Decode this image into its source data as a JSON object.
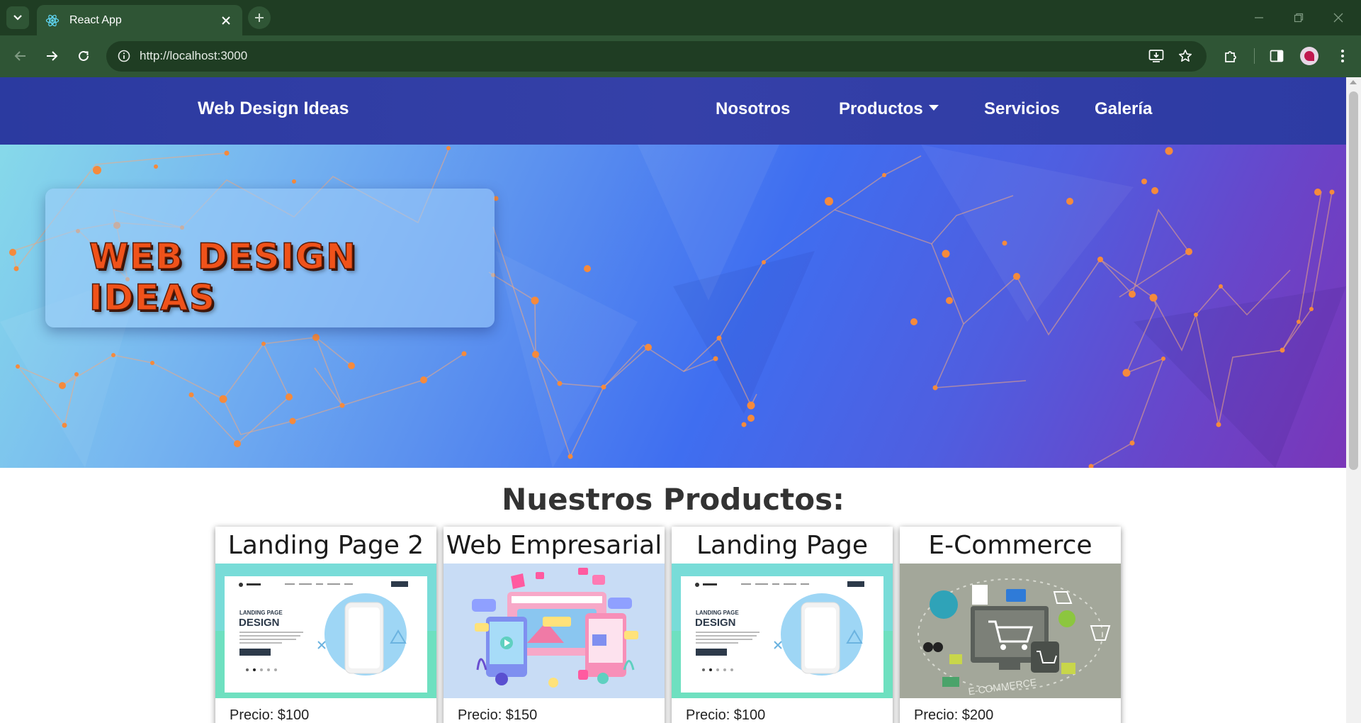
{
  "browser": {
    "tab_title": "React App",
    "url": "http://localhost:3000",
    "colors": {
      "frame": "#1f3d23",
      "toolbar": "#2f5535"
    }
  },
  "site": {
    "brand": "Web Design Ideas",
    "nav": {
      "nosotros": "Nosotros",
      "productos": "Productos",
      "servicios": "Servicios",
      "galeria": "Galería"
    },
    "hero_title": "Web Design Ideas",
    "section_title": "Nuestros Productos:",
    "products": [
      {
        "title": "Landing Page 2",
        "price": "Precio: $100",
        "image": "landing-page-mockup"
      },
      {
        "title": "Web Empresarial",
        "price": "Precio: $150",
        "image": "business-web-illustration"
      },
      {
        "title": "Landing Page",
        "price": "Precio: $100",
        "image": "landing-page-mockup"
      },
      {
        "title": "E-Commerce",
        "price": "Precio: $200",
        "image": "ecommerce-illustration"
      }
    ],
    "colors": {
      "navbar": "#2f3da4",
      "accent_orange": "#f0521a"
    }
  }
}
